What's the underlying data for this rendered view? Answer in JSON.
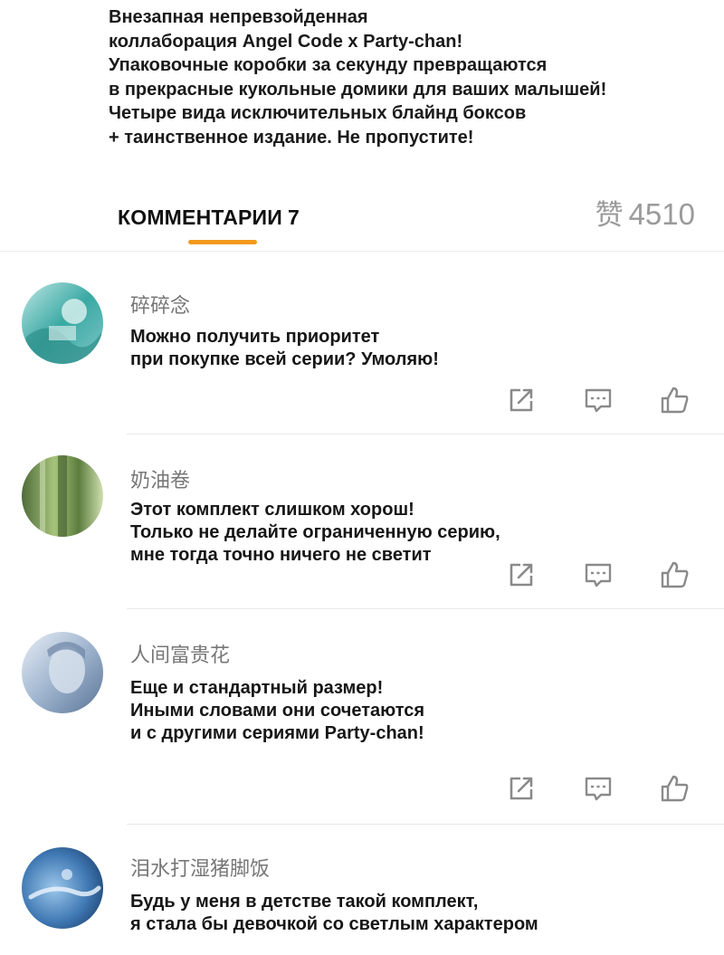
{
  "post": {
    "lines": [
      "Внезапная непревзойденная",
      "коллаборация Angel Code x Party-chan!",
      "Упаковочные коробки за секунду превращаются",
      "в прекрасные кукольные домики для ваших малышей!",
      "Четыре вида исключительных блайнд боксов",
      "+ таинственное издание. Не пропустите!"
    ]
  },
  "comments_header": {
    "tab_label": "КОММЕНТАРИИ",
    "tab_count": "7",
    "likes_glyph": "赞",
    "likes_count": "4510"
  },
  "colors": {
    "accent": "#f39a1e",
    "icon": "#8a8a8a",
    "username": "#777777"
  },
  "comments": [
    {
      "username": "碎碎念",
      "lines": [
        "Можно получить приоритет",
        "при покупке всей серии? Умоляю!"
      ]
    },
    {
      "username": "奶油卷",
      "lines": [
        "Этот комплект слишком хорош!",
        "Только не делайте ограниченную серию,",
        "мне тогда точно ничего не светит"
      ]
    },
    {
      "username": "人间富贵花",
      "lines": [
        "Еще и стандартный размер!",
        "Иными словами они сочетаются",
        "и с другими сериями Party-chan!"
      ]
    },
    {
      "username": "泪水打湿猪脚饭",
      "lines": [
        "Будь у меня в детстве такой комплект,",
        "я стала бы девочкой со светлым характером"
      ]
    }
  ],
  "icons": {
    "share": "share-icon",
    "reply": "reply-icon",
    "like": "thumbs-up-icon"
  }
}
